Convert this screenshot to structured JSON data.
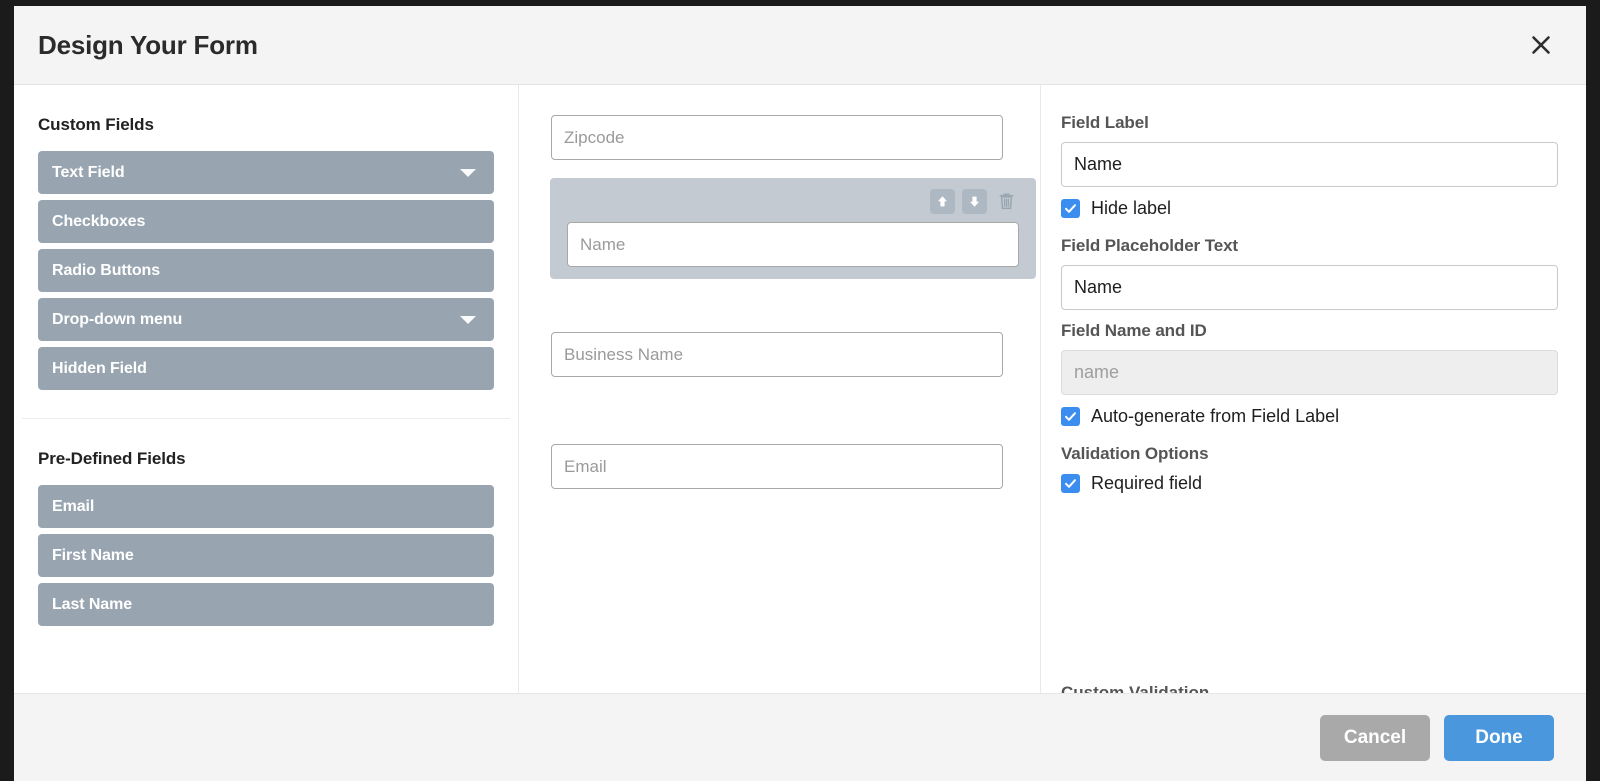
{
  "header": {
    "title": "Design Your Form",
    "close_icon": "close-icon"
  },
  "left_panel": {
    "custom_fields": {
      "title": "Custom Fields",
      "items": [
        {
          "label": "Text Field",
          "has_caret": true
        },
        {
          "label": "Checkboxes",
          "has_caret": false
        },
        {
          "label": "Radio Buttons",
          "has_caret": false
        },
        {
          "label": "Drop-down menu",
          "has_caret": true
        },
        {
          "label": "Hidden Field",
          "has_caret": false
        }
      ]
    },
    "predefined_fields": {
      "title": "Pre-Defined Fields",
      "items": [
        {
          "label": "Email"
        },
        {
          "label": "First Name"
        },
        {
          "label": "Last Name"
        }
      ]
    }
  },
  "center_panel": {
    "fields": [
      {
        "placeholder": "Zipcode",
        "selected": false
      },
      {
        "placeholder": "Name",
        "selected": true
      },
      {
        "placeholder": "Business Name",
        "selected": false
      },
      {
        "placeholder": "Email",
        "selected": false
      }
    ],
    "tools": {
      "move_up": "arrow-up-icon",
      "move_down": "arrow-down-icon",
      "delete": "trash-icon"
    }
  },
  "right_panel": {
    "field_label": {
      "label": "Field Label",
      "value": "Name"
    },
    "hide_label": {
      "label": "Hide label",
      "checked": true
    },
    "field_placeholder": {
      "label": "Field Placeholder Text",
      "value": "Name"
    },
    "field_name_id": {
      "label": "Field Name and ID",
      "value": "name",
      "readonly": true
    },
    "auto_generate": {
      "label": "Auto-generate from Field Label",
      "checked": true
    },
    "validation_options": {
      "label": "Validation Options"
    },
    "required_field": {
      "label": "Required field",
      "checked": true
    },
    "cut_off_section": {
      "label": "Custom Validation"
    }
  },
  "footer": {
    "cancel_label": "Cancel",
    "done_label": "Done"
  },
  "colors": {
    "accent_blue": "#4a97dd",
    "checkbox_blue": "#3b8ef0",
    "pill_gray": "#98a5b0",
    "selected_block": "#c3cad2",
    "cancel_gray": "#a9a9a9",
    "header_bg": "#f4f4f4"
  }
}
